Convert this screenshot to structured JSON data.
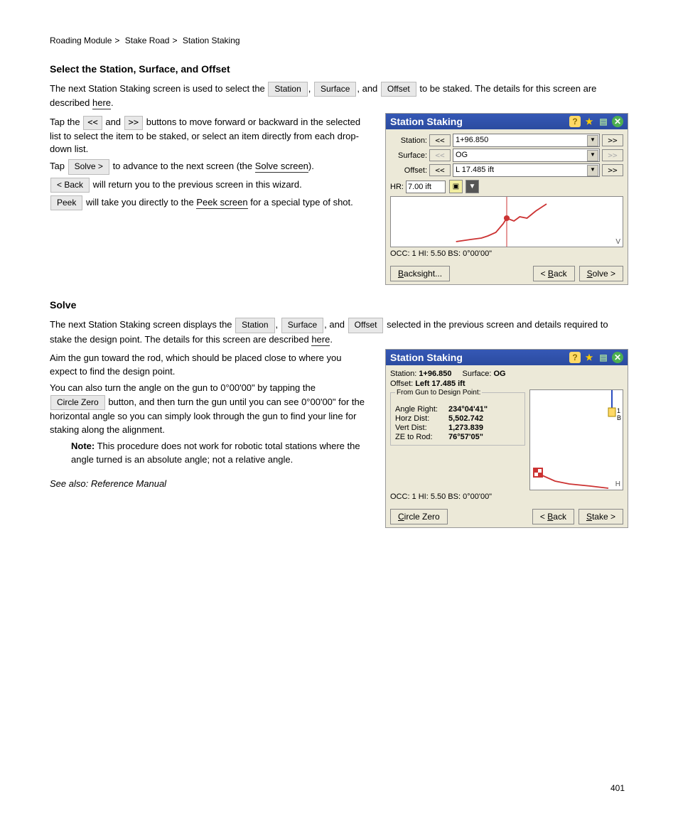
{
  "breadcrumb": [
    "Roading Module",
    "Stake Road",
    "Station Staking"
  ],
  "section1": {
    "heading": "Select the Station, Surface, and Offset",
    "intro": "The next Station Staking screen is used to select the",
    "intro_items": [
      "Station",
      "Surface",
      "Offset"
    ],
    "intro_tail": "to be staked. The details for this screen are described",
    "here_label": "here",
    "prev": "<<",
    "next": ">>",
    "prev_next_text": "Tap the ",
    "prev_next_mid": " and ",
    "prev_next_tail": " buttons to move forward or backward in the selected list to select the item to be staked, or select an item directly from each drop-down list.",
    "solve_text1": "Tap ",
    "solve_btn": "Solve >",
    "solve_text2": " to advance to the next screen (the ",
    "solve_link": "Solve screen",
    "solve_text3": ").",
    "back_btn": "< Back",
    "back_text": " will return you to the previous screen in this wizard.",
    "peek_btn": "Peek",
    "peek_text": " will take you directly to the ",
    "peek_link": "Peek screen",
    "peek_tail": " for a special type of shot."
  },
  "section2": {
    "heading": "Solve",
    "intro": "The next Station Staking screen displays the",
    "items": [
      "Station",
      "Surface",
      "Offset"
    ],
    "intro_tail": "selected in the previous screen and details required to stake the design point. The details for this screen are described",
    "details_link": "here",
    "gun_text": "Aim the gun toward the rod, which should be placed close to where you expect to find the design point.",
    "anglezero_text": "You can also turn the angle on the gun to 0°00'00\" by tapping the ",
    "circlezero_btn": "Circle Zero",
    "anglezero_tail": " button, and then turn the gun until you can see 0°00'00\" for the horizontal angle so you can simply look through the gun to find your line for staking along the alignment.",
    "note": "Note: This procedure does not work for robotic total stations where the angle turned is an absolute angle; not a relative angle.",
    "ref": "See also: Reference Manual"
  },
  "panel1": {
    "title": "Station Staking",
    "station_label": "Station:",
    "station": "1+96.850",
    "surface_label": "Surface:",
    "surface": "OG",
    "offset_label": "Offset:",
    "offset": "L 17.485 ift",
    "hr_label": "HR:",
    "hr": "7.00 ift",
    "status": "OCC: 1  HI: 5.50  BS: 0°00'00\"",
    "backsight": "Backsight...",
    "back": "< Back",
    "solve": "Solve >",
    "v": "V"
  },
  "panel2": {
    "title": "Station Staking",
    "station_label": "Station:",
    "station": "1+96.850",
    "surface_label": "Surface:",
    "surface": "OG",
    "offset_label": "Offset:",
    "offset_val": "Left 17.485 ift",
    "fieldset": "From Gun to Design Point:",
    "angle_k": "Angle Right:",
    "angle_v": "234°04'41\"",
    "horz_k": "Horz Dist:",
    "horz_v": "5,502.742",
    "vert_k": "Vert Dist:",
    "vert_v": "1,273.839",
    "ze_k": "ZE to Rod:",
    "ze_v": "76°57'05\"",
    "status": "OCC: 1  HI: 5.50  BS: 0°00'00\"",
    "circle": "Circle Zero",
    "back": "< Back",
    "stake": "Stake >",
    "h": "H"
  },
  "page": "401"
}
